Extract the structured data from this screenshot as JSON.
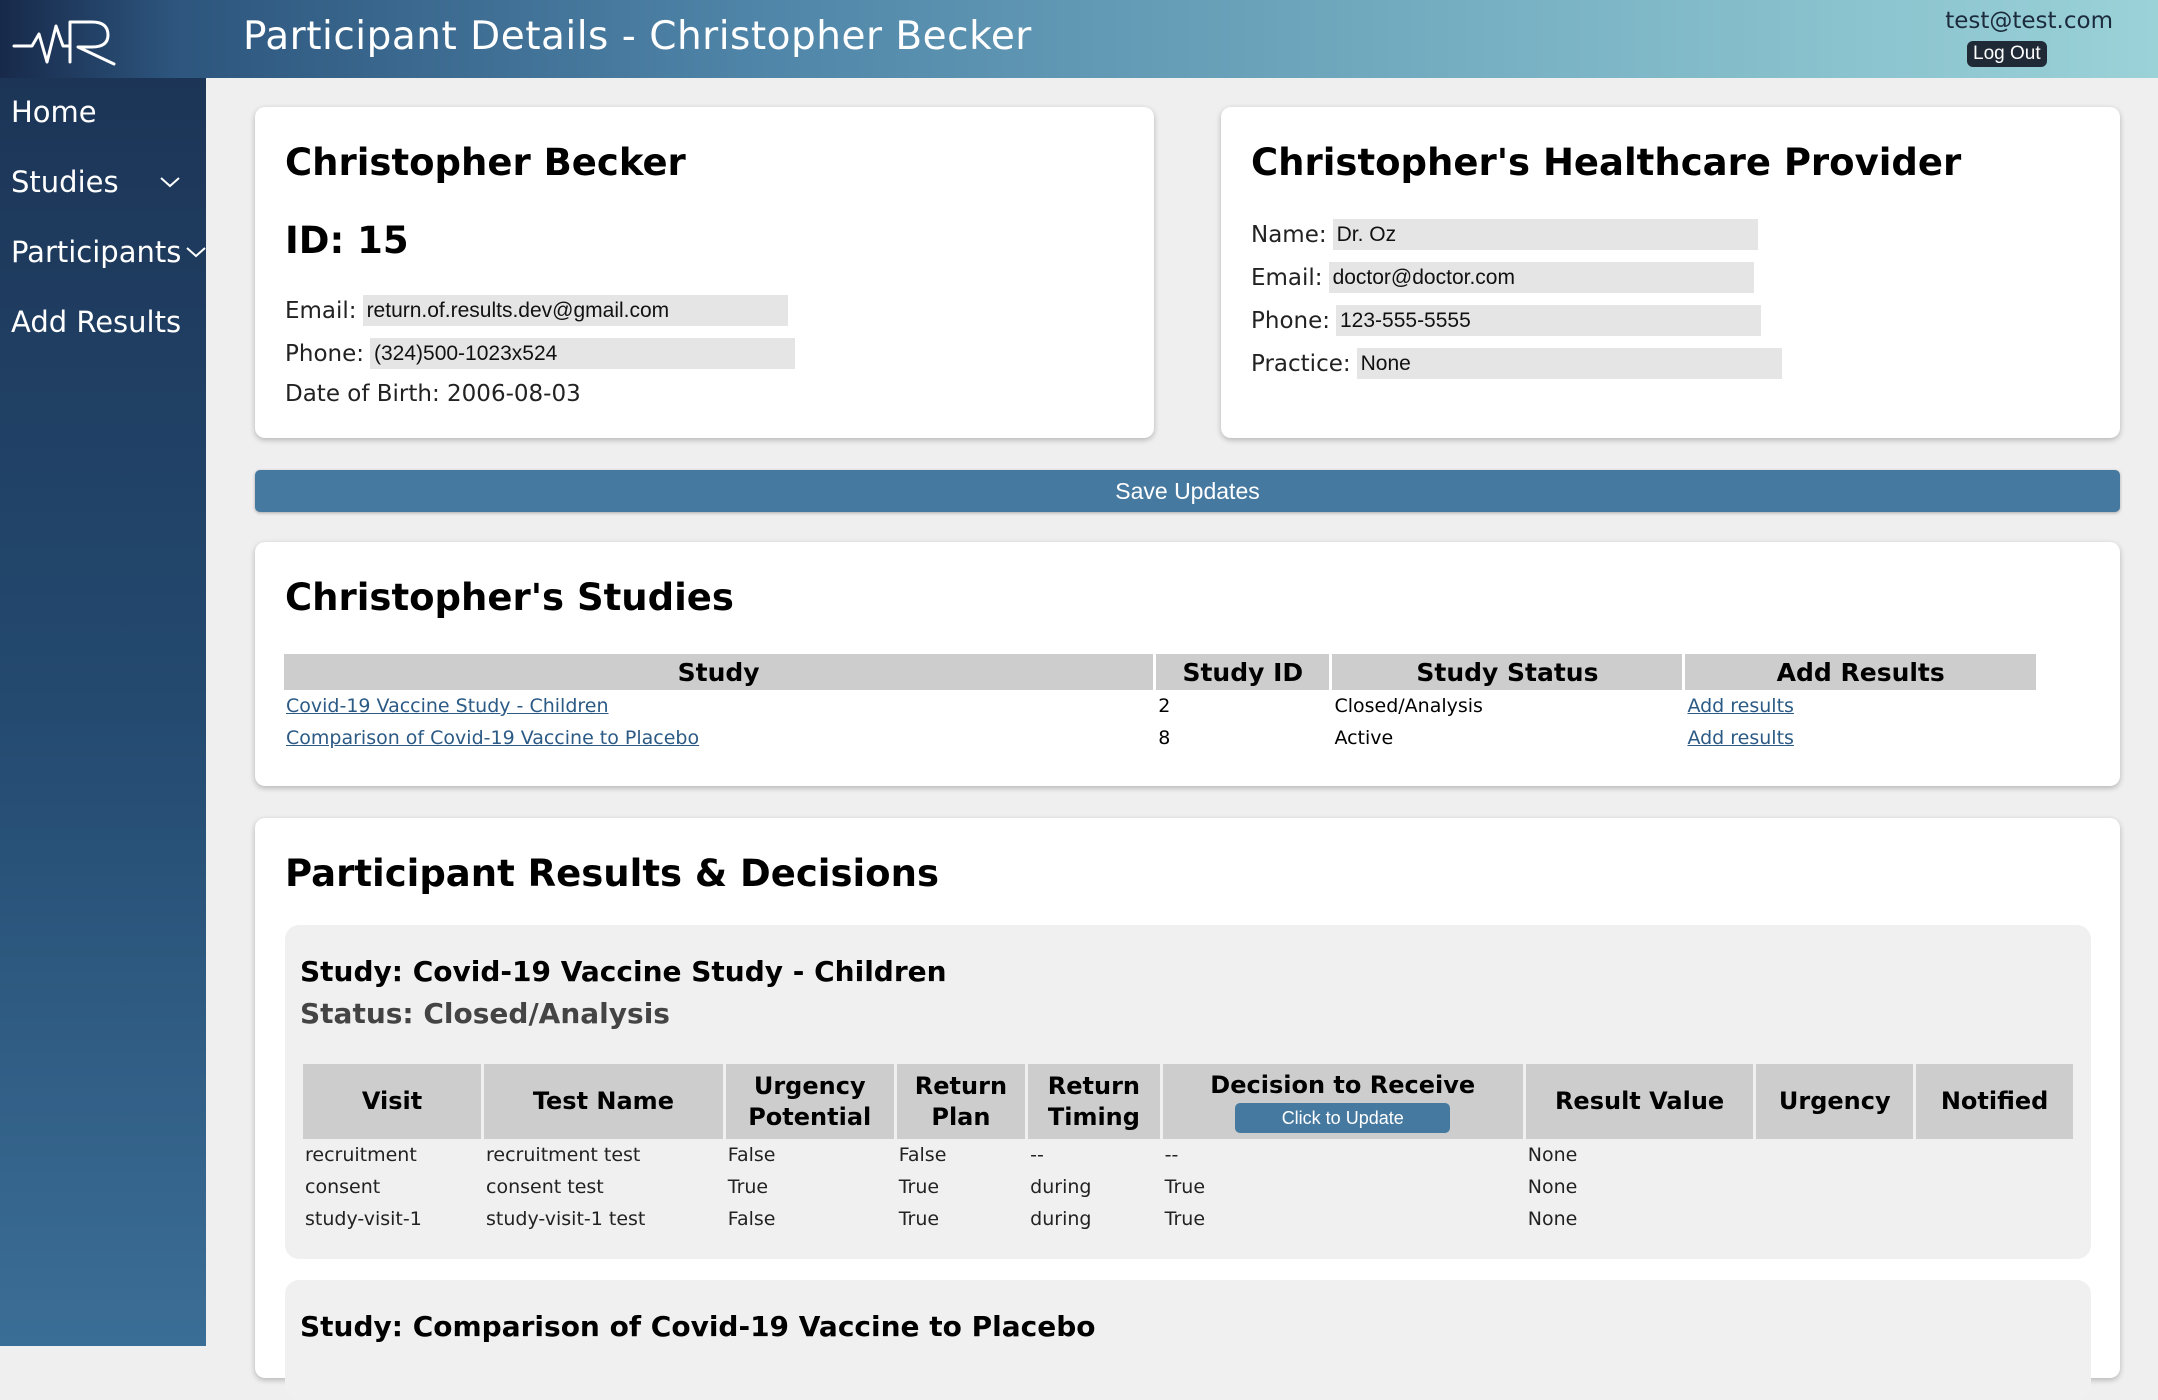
{
  "header": {
    "title": "Participant Details - Christopher Becker",
    "user_email": "test@test.com",
    "logout_label": "Log Out"
  },
  "sidebar": {
    "items": [
      {
        "label": "Home"
      },
      {
        "label": "Studies"
      },
      {
        "label": "Participants"
      },
      {
        "label": "Add Results"
      }
    ]
  },
  "participant": {
    "name": "Christopher Becker",
    "id_label": "ID: 15",
    "email_label": "Email:",
    "email": "return.of.results.dev@gmail.com",
    "phone_label": "Phone:",
    "phone": "(324)500-1023x524",
    "dob_label": "Date of Birth: 2006-08-03"
  },
  "provider": {
    "heading": "Christopher's Healthcare Provider",
    "name_label": "Name:",
    "name": "Dr. Oz",
    "email_label": "Email:",
    "email": "doctor@doctor.com",
    "phone_label": "Phone:",
    "phone": "123-555-5555",
    "practice_label": "Practice:",
    "practice": "None"
  },
  "save_label": "Save Updates",
  "studies": {
    "heading": "Christopher's Studies",
    "columns": [
      "Study",
      "Study ID",
      "Study Status",
      "Add Results"
    ],
    "rows": [
      {
        "study": "Covid-19 Vaccine Study - Children",
        "id": "2",
        "status": "Closed/Analysis",
        "action": "Add results"
      },
      {
        "study": "Comparison of Covid-19 Vaccine to Placebo",
        "id": "8",
        "status": "Active",
        "action": "Add results"
      }
    ]
  },
  "results": {
    "heading": "Participant Results & Decisions",
    "study1": {
      "title": "Study: Covid-19 Vaccine Study - Children",
      "status": "Status: Closed/Analysis",
      "columns": {
        "visit": "Visit",
        "test_name": "Test Name",
        "urgency_potential": "Urgency Potential",
        "return_plan": "Return Plan",
        "return_timing": "Return Timing",
        "decision": "Decision to Receive",
        "update_button": "Click to Update",
        "result_value": "Result Value",
        "urgency": "Urgency",
        "notified": "Notified"
      },
      "rows": [
        {
          "visit": "recruitment",
          "test": "recruitment test",
          "urg_pot": "False",
          "plan": "False",
          "timing": "--",
          "decision": "--",
          "value": "None",
          "urgency": "",
          "notified": ""
        },
        {
          "visit": "consent",
          "test": "consent test",
          "urg_pot": "True",
          "plan": "True",
          "timing": "during",
          "decision": "True",
          "value": "None",
          "urgency": "",
          "notified": ""
        },
        {
          "visit": "study-visit-1",
          "test": "study-visit-1 test",
          "urg_pot": "False",
          "plan": "True",
          "timing": "during",
          "decision": "True",
          "value": "None",
          "urgency": "",
          "notified": ""
        }
      ]
    },
    "study2": {
      "title": "Study: Comparison of Covid-19 Vaccine to Placebo"
    }
  },
  "icons": {
    "logo": "mr-logo-icon",
    "chevron": "chevron-down-icon"
  }
}
